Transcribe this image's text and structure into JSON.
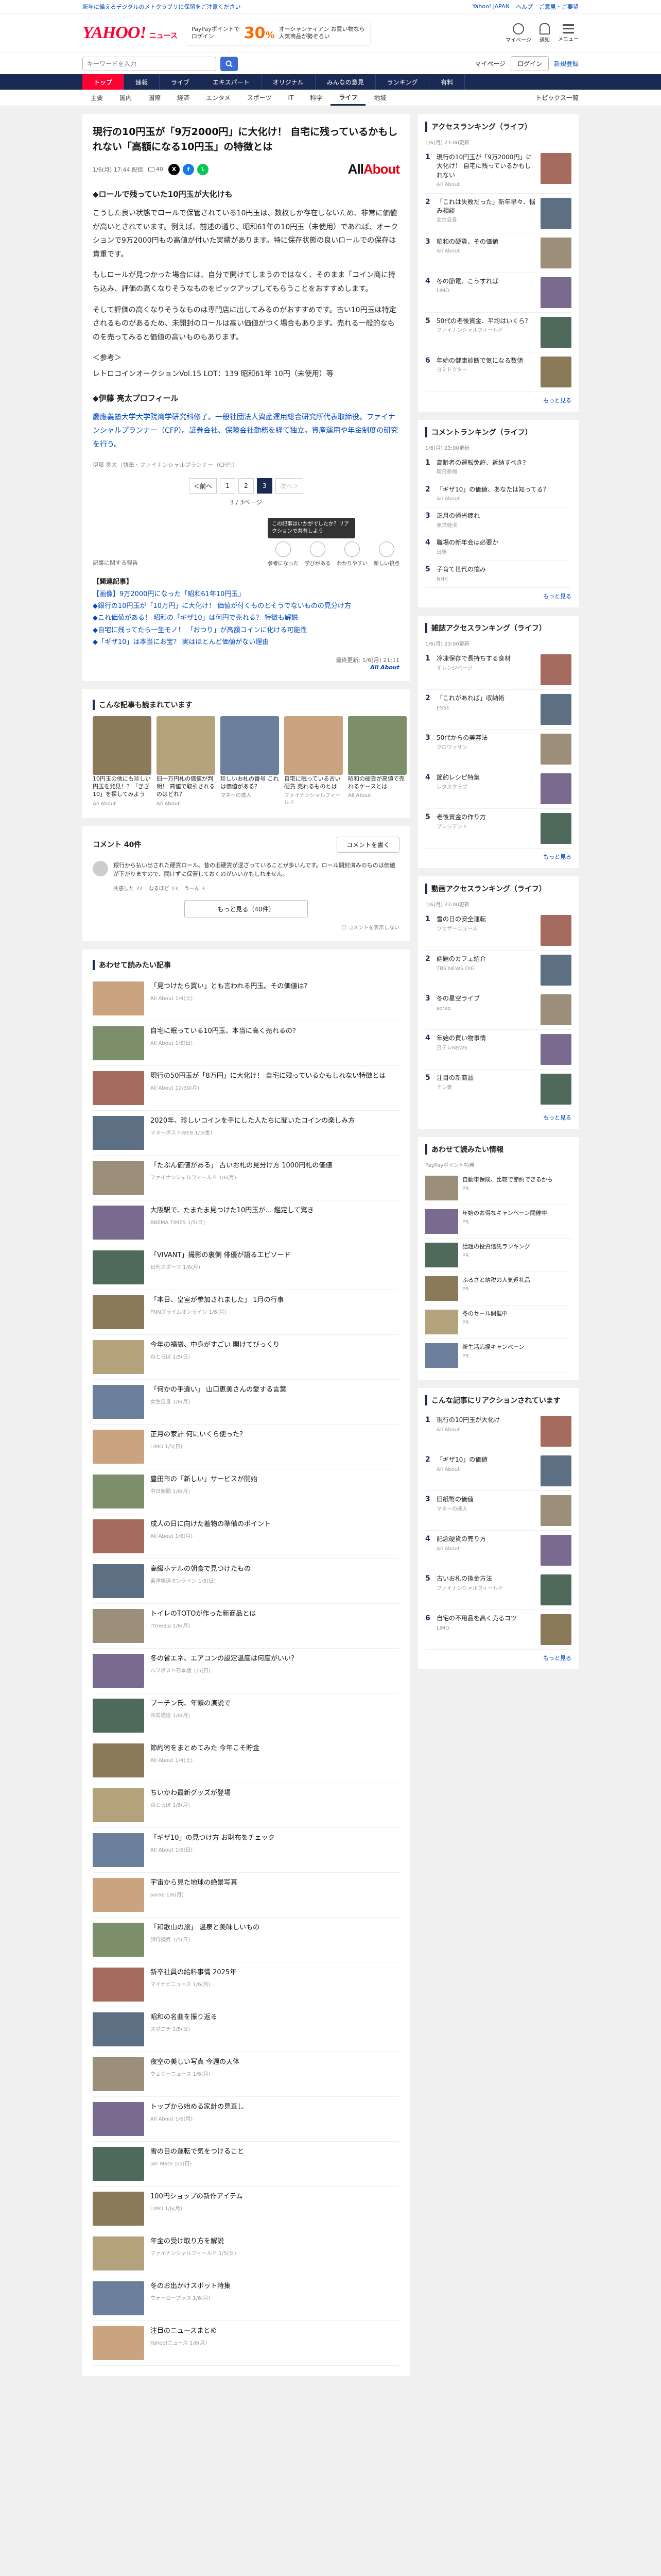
{
  "topbar": {
    "left": "新年に備えるデジタルのメトクラブリに保留をご注意ください",
    "yahoo_japan": "Yahoo! JAPAN",
    "help": "ヘルプ",
    "notify": "ご意見・ご要望"
  },
  "header": {
    "logo": "YAHOO!",
    "logo_sub": "ニュース",
    "promo_big": "30",
    "promo_unit": "%",
    "promo_line1": "PayPayポイントで",
    "promo_line2": "ロゲイン",
    "promo_line3": "オーシャンティアン お買い物なら",
    "promo_line4": "人気商品が勢ぞろい",
    "icons": [
      {
        "label": "マイページ"
      },
      {
        "label": "通知"
      },
      {
        "label": "メニュー"
      }
    ]
  },
  "search": {
    "placeholder": "キーワードを入力",
    "mypage": "マイページ",
    "login": "ログイン",
    "register": "新規登録"
  },
  "nav1": [
    "トップ",
    "速報",
    "ライブ",
    "エキスパート",
    "オリジナル",
    "みんなの意見",
    "ランキング",
    "有料"
  ],
  "nav2": [
    "主要",
    "国内",
    "国際",
    "経済",
    "エンタメ",
    "スポーツ",
    "IT",
    "科学",
    "ライフ",
    "地域"
  ],
  "nav2_active": "ライフ",
  "nav2_right": "トピックス一覧",
  "article": {
    "title": "現行の10円玉が「9万2000円」に大化け！ 自宅に残っているかもしれない「高額になる10円玉」の特徴とは",
    "date": "1/6(月) 17:44 配信",
    "publisher": "All About",
    "publisher_mark": "About",
    "comment_count": "40",
    "heading1": "◆ロールで残っていた10円玉が大化けも",
    "p1": "こうした良い状態でロールで保管されている10円玉は、数枚しか存在しないため、非常に価値が高いとされています。例えば、前述の通り、昭和61年の10円玉（未使用）であれば、オークションで9万2000円もの高値が付いた実績があります。特に保存状態の良いロールでの保存は貴重です。",
    "p2": "もしロールが見つかった場合には、自分で開けてしまうのではなく、そのまま「コイン商に持ち込み、評価の高くなりそうなものをピックアップしてもらうことをおすすめします。",
    "p3": "そして評価の高くなりそうなものは専門店に出してみるのがおすすめです。古い10円玉は特定されるものがあるため、未開封のロールは高い価値がつく場合もあります。売れる一般的なものを売ってみると価値の高いものもあります。",
    "source_label": "＜参考＞",
    "source_text": "レトロコインオークションVol.15 LOT：139 昭和61年 10円（未使用）等",
    "profile_heading": "◆伊藤 亮太プロフィール",
    "profile": "慶應義塾大学大学院商学研究科修了。一般社団法人資産運用総合研究所代表取締役。ファイナンシャルプランナー（CFP）。証券会社、保険会社勤務を経て独立。資産運用や年金制度の研究を行う。",
    "photo_note": "伊藤 亮太（執筆・ファイナンシャルプランナー（CFP））",
    "pager": [
      "＜前へ",
      "1",
      "2",
      "3",
      "次へ＞"
    ],
    "pager_current": "3",
    "page_indicator": "3 / 3ページ",
    "tooltip": "この記事はいかがでしたか？リアクションで共有しよう",
    "reactions": [
      {
        "label": "参考になった"
      },
      {
        "label": "学びがある"
      },
      {
        "label": "わかりやすい"
      },
      {
        "label": "新しい視点"
      }
    ],
    "report_link": "記事に関する報告",
    "related_head": "【関連記事】",
    "related": [
      "【画像】9万2000円になった「昭和61年10円玉」",
      "◆銀行の10円玉が「10万円」に大化け！ 価値が付くものとそうでないものの見分け方",
      "◆これ価値がある！ 昭和の「ギザ10」は何円で売れる？ 特徴も解説",
      "◆自宅に残ってたら一生モノ！ 「おつり」が高額コインに化ける可能性",
      "◆「ギザ10」は本当にお宝？ 実はほとんど価値がない理由"
    ],
    "footnote_date": "最終更新: 1/6(月) 21:11",
    "footnote_brand": "All About"
  },
  "recommend": {
    "title": "こんな記事も読まれています",
    "items": [
      {
        "text": "10円玉の他にも珍しい円玉を発見！？「ぎざ10」を探してみよう",
        "src": "All About"
      },
      {
        "text": "旧一万円札の価値が判明！ 高値で取引されるのはどれ？",
        "src": "All About"
      },
      {
        "text": "珍しいお札の番号 これは価値がある？",
        "src": "マネーの達人"
      },
      {
        "text": "自宅に眠っている古い硬貨 売れるものとは",
        "src": "ファイナンシャルフィールド"
      },
      {
        "text": "昭和の硬貨が高値で売れるケースとは",
        "src": "All About"
      }
    ]
  },
  "comments": {
    "title": "コメント",
    "count": "40件",
    "button": "コメントを書く",
    "first_text": "銀行から払い出された硬貨ロール。昔の旧硬貨が混ざっていることが多いんです。ロール開封済みのものは価値が下がりますので、開けずに保管しておくのがいいかもしれません。",
    "actions": [
      {
        "label": "共感した",
        "count": "72"
      },
      {
        "label": "なるほど",
        "count": "13"
      },
      {
        "label": "うーん",
        "count": "3"
      }
    ],
    "more": "もっと見る（40件）",
    "hide_note": "コメントを表示しない"
  },
  "also_read": {
    "title": "あわせて読みたい記事",
    "items": [
      {
        "text": "「見つけたら買い」とも言われる円玉。その価値は？",
        "src": "All About 1/4(土)"
      },
      {
        "text": "自宅に眠っている10円玉、本当に高く売れるの？",
        "src": "All About 1/5(日)"
      },
      {
        "text": "現行の50円玉が「8万円」に大化け！ 自宅に残っているかもしれない特徴とは",
        "src": "All About 12/30(月)"
      },
      {
        "text": "2020年、珍しいコインを手にした人たちに聞いたコインの楽しみ方",
        "src": "マネーポストWEB 1/3(金)"
      },
      {
        "text": "「たぶん価値がある」 古いお札の見分け方 1000円札の価値",
        "src": "ファイナンシャルフィールド 1/6(月)"
      },
      {
        "text": "大阪駅で、たまたま見つけた10円玉が… 鑑定して驚き",
        "src": "ABEMA TIMES 1/5(日)"
      },
      {
        "text": "「VIVANT」撮影の裏側 俳優が語るエピソード",
        "src": "日刊スポーツ 1/6(月)"
      },
      {
        "text": "「本日、皇室が参加されました」 1月の行事",
        "src": "FNNプライムオンライン 1/6(月)"
      },
      {
        "text": "今年の福袋、中身がすごい 開けてびっくり",
        "src": "ねとらぼ 1/5(日)"
      },
      {
        "text": "「何かの手違い」 山口恵美さんの愛する言葉",
        "src": "女性自身 1/6(月)"
      },
      {
        "text": "正月の家計 何にいくら使った？",
        "src": "LIMO 1/5(日)"
      },
      {
        "text": "豊田市の「新しい」サービスが開始",
        "src": "中日新聞 1/6(月)"
      },
      {
        "text": "成人の日に向けた着物の準備のポイント",
        "src": "All About 1/6(月)"
      },
      {
        "text": "高級ホテルの朝食で見つけたもの",
        "src": "東洋経済オンライン 1/5(日)"
      },
      {
        "text": "トイレのTOTOが作った新商品とは",
        "src": "ITmedia 1/6(月)"
      },
      {
        "text": "冬の省エネ、エアコンの設定温度は何度がいい？",
        "src": "ハフポスト日本版 1/5(日)"
      },
      {
        "text": "プーチン氏、年頭の演説で",
        "src": "共同通信 1/6(月)"
      },
      {
        "text": "節約術をまとめてみた 今年こそ貯金",
        "src": "All About 1/4(土)"
      },
      {
        "text": "ちいかわ最新グッズが登場",
        "src": "ねとらぼ 1/6(月)"
      },
      {
        "text": "「ギザ10」の見つけ方 お財布をチェック",
        "src": "All About 1/5(日)"
      },
      {
        "text": "宇宙から見た地球の絶景写真",
        "src": "sorae 1/6(月)"
      },
      {
        "text": "「和歌山の旅」 温泉と美味しいもの",
        "src": "旅行読売 1/5(日)"
      },
      {
        "text": "新卒社員の給料事情 2025年",
        "src": "マイナビニュース 1/6(月)"
      },
      {
        "text": "昭和の名曲を振り返る",
        "src": "スポニチ 1/5(日)"
      },
      {
        "text": "夜空の美しい写真 今週の天体",
        "src": "ウェザーニュース 1/6(月)"
      },
      {
        "text": "トップから始める家計の見直し",
        "src": "All About 1/6(月)"
      },
      {
        "text": "雪の日の運転で気をつけること",
        "src": "JAF Mate 1/5(日)"
      },
      {
        "text": "100円ショップの新作アイテム",
        "src": "LIMO 1/6(月)"
      },
      {
        "text": "年金の受け取り方を解説",
        "src": "ファイナンシャルフィールド 1/5(日)"
      },
      {
        "text": "冬のお出かけスポット特集",
        "src": "ウォーカープラス 1/6(月)"
      },
      {
        "text": "注目のニュースまとめ",
        "src": "Yahoo!ニュース 1/6(月)"
      }
    ]
  },
  "sidebar": {
    "access_title": "アクセスランキング（ライフ）",
    "access_sub": "1/6(月) 23:00更新",
    "access": [
      {
        "text": "現行の10円玉が「9万2000円」に大化け！ 自宅に残っているかもしれない",
        "src": "All About"
      },
      {
        "text": "「これは失敗だった」新年早々、悩み相談",
        "src": "女性自身"
      },
      {
        "text": "昭和の硬貨、その価値",
        "src": "All About"
      },
      {
        "text": "冬の節電、こうすれば",
        "src": "LIMO"
      },
      {
        "text": "50代の老後資金、平均はいくら？",
        "src": "ファイナンシャルフィールド"
      },
      {
        "text": "年始の健康診断で気になる数値",
        "src": "ヨミドクター"
      }
    ],
    "comment_title": "コメントランキング（ライフ）",
    "comment_sub": "1/6(月) 23:00更新",
    "comment": [
      {
        "text": "高齢者の運転免許、返納すべき？",
        "src": "朝日新聞"
      },
      {
        "text": "「ギザ10」の価値、あなたは知ってる？",
        "src": "All About"
      },
      {
        "text": "正月の帰省疲れ",
        "src": "東洋経済"
      },
      {
        "text": "職場の新年会は必要か",
        "src": "日経"
      },
      {
        "text": "子育て世代の悩み",
        "src": "NHK"
      }
    ],
    "topic_title": "雑誌アクセスランキング（ライフ）",
    "topic_sub": "1/6(月) 23:00更新",
    "topic": [
      {
        "text": "冷凍保存で長持ちする食材",
        "src": "オレンジページ"
      },
      {
        "text": "「これがあれば」収納術",
        "src": "ESSE"
      },
      {
        "text": "50代からの美容法",
        "src": "クロワッサン"
      },
      {
        "text": "節約レシピ特集",
        "src": "レタスクラブ"
      },
      {
        "text": "老後資金の作り方",
        "src": "プレジデント"
      }
    ],
    "video_title": "動画アクセスランキング（ライフ）",
    "video_sub": "1/6(月) 23:00更新",
    "video": [
      {
        "text": "雪の日の安全運転",
        "src": "ウェザーニュース"
      },
      {
        "text": "話題のカフェ紹介",
        "src": "TBS NEWS DIG"
      },
      {
        "text": "冬の星空ライブ",
        "src": "sorae"
      },
      {
        "text": "年始の買い物事情",
        "src": "日テレNEWS"
      },
      {
        "text": "注目の新商品",
        "src": "テレ東"
      }
    ],
    "pr_title": "あわせて読みたい情報",
    "pr_sub": "PayPayポイント特典",
    "pr": [
      {
        "text": "自動車保険、比較で節約できるかも",
        "tag": "PR"
      },
      {
        "text": "年始のお得なキャンペーン開催中",
        "tag": "PR"
      },
      {
        "text": "話題の投資信託ランキング",
        "tag": "PR"
      },
      {
        "text": "ふるさと納税の人気返礼品",
        "tag": "PR"
      },
      {
        "text": "冬のセール開催中",
        "tag": "PR"
      },
      {
        "text": "新生活応援キャンペーン",
        "tag": "PR"
      }
    ],
    "reaction_title": "こんな記事にリアクションされています",
    "reaction": [
      {
        "text": "現行の10円玉が大化け",
        "src": "All About"
      },
      {
        "text": "「ギザ10」の価値",
        "src": "All About"
      },
      {
        "text": "旧紙幣の価値",
        "src": "マネーの達人"
      },
      {
        "text": "記念硬貨の売り方",
        "src": "All About"
      },
      {
        "text": "古いお札の換金方法",
        "src": "ファイナンシャルフィールド"
      },
      {
        "text": "自宅の不用品を高く売るコツ",
        "src": "LIMO"
      }
    ],
    "more_label": "もっと見る"
  },
  "colors": {
    "brand_red": "#ff0033",
    "nav_navy": "#1b2a52",
    "link_blue": "#0047c0"
  }
}
